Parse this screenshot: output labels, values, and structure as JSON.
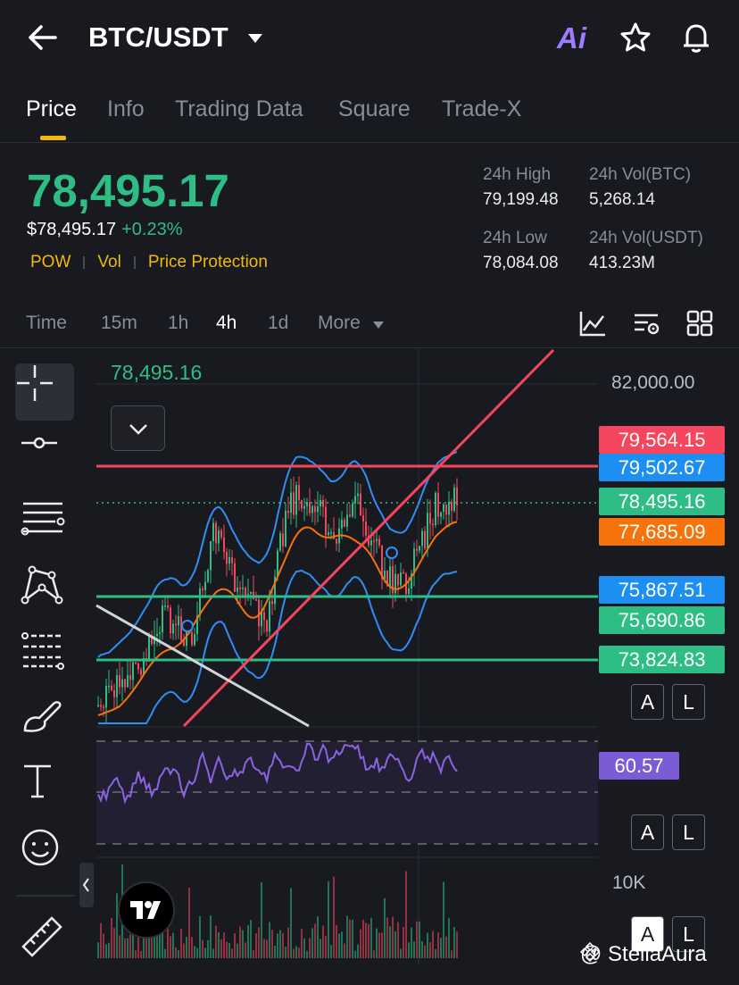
{
  "header": {
    "pair": "BTC/USDT",
    "ai_label": "Ai"
  },
  "tabs": [
    {
      "label": "Price",
      "active": true
    },
    {
      "label": "Info",
      "active": false
    },
    {
      "label": "Trading Data",
      "active": false
    },
    {
      "label": "Square",
      "active": false
    },
    {
      "label": "Trade-X",
      "active": false
    }
  ],
  "ticker": {
    "last_price": "78,495.17",
    "usd_price": "$78,495.17",
    "change": "+0.23%",
    "tags": [
      "POW",
      "Vol",
      "Price Protection"
    ],
    "stats": {
      "high_label": "24h High",
      "high_value": "79,199.48",
      "vol_btc_label": "24h Vol(BTC)",
      "vol_btc_value": "5,268.14",
      "low_label": "24h Low",
      "low_value": "78,084.08",
      "vol_usdt_label": "24h Vol(USDT)",
      "vol_usdt_value": "413.23M"
    }
  },
  "intervals": {
    "time_label": "Time",
    "options": [
      "15m",
      "1h",
      "4h",
      "1d"
    ],
    "active": "4h",
    "more_label": "More"
  },
  "chart": {
    "crosshair_price": "78,495.16",
    "axis_top": "82,000.00",
    "price_labels": [
      {
        "value": "79,564.15",
        "color": "#f6465d"
      },
      {
        "value": "79,502.67",
        "color": "#1e8ff2"
      },
      {
        "value": "78,495.16",
        "color": "#2ebd85"
      },
      {
        "value": "77,685.09",
        "color": "#f6720b"
      },
      {
        "value": "75,867.51",
        "color": "#1e8ff2"
      },
      {
        "value": "75,690.86",
        "color": "#2ebd85"
      },
      {
        "value": "73,824.83",
        "color": "#2ebd85"
      }
    ],
    "rsi_value": "60.57",
    "rsi_color": "#7b5cd6",
    "volume_axis": "10K",
    "a_label": "A",
    "l_label": "L"
  },
  "watermark": "@ StellaAura",
  "colors": {
    "up": "#2ebd85",
    "down": "#f6465d",
    "accent": "#f0b90b",
    "boll": "#2f8ef5",
    "ma": "#f6720b",
    "rsi": "#8a63e0"
  }
}
